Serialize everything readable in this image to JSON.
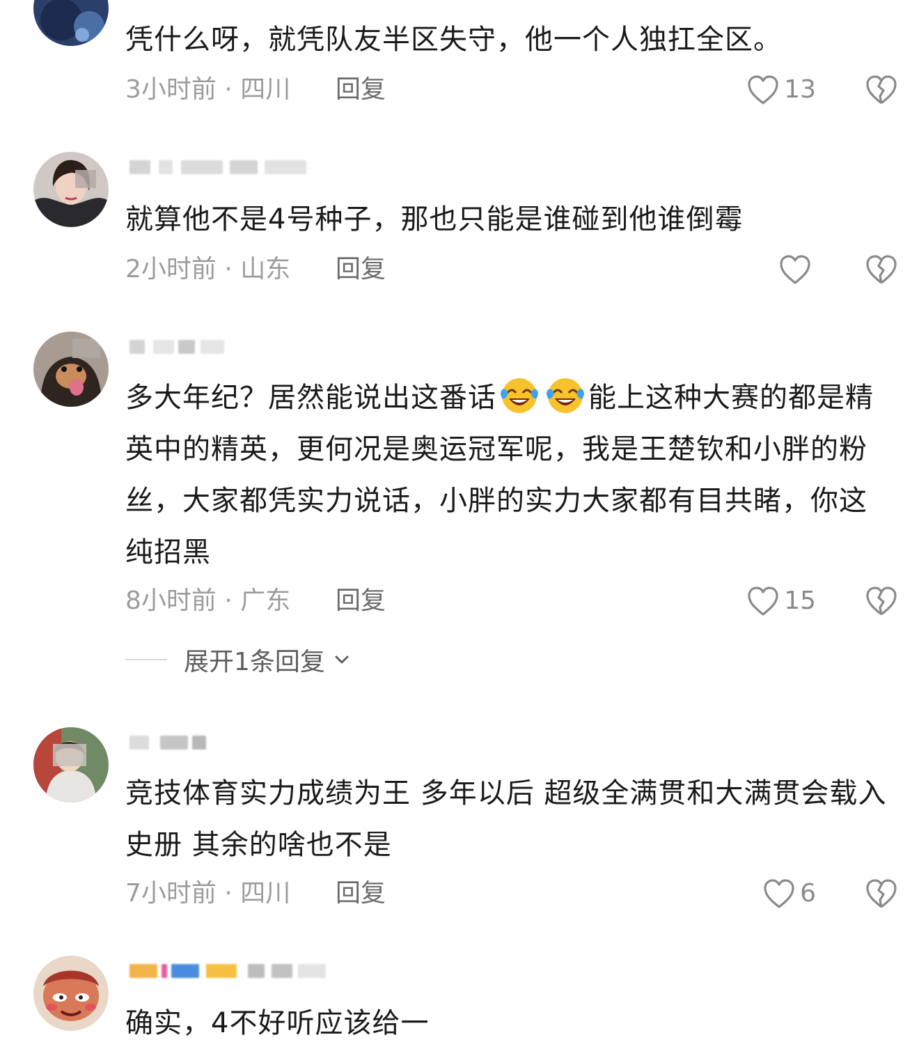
{
  "comments": [
    {
      "text": "凭什么呀，就凭队友半区失守，他一个人独扛全区。",
      "time": "3小时前 · 四川",
      "reply": "回复",
      "likes": "13"
    },
    {
      "text": "就算他不是4号种子，那也只能是谁碰到他谁倒霉",
      "time": "2小时前 · 山东",
      "reply": "回复",
      "likes": ""
    },
    {
      "text_part1": "多大年纪？居然能说出这番话",
      "text_part2": "能上这种大赛的都是精英中的精英，更何况是奥运冠军呢，我是王楚钦和小胖的粉丝，大家都凭实力说话，小胖的实力大家都有目共睹，你这纯招黑",
      "time": "8小时前 · 广东",
      "reply": "回复",
      "likes": "15",
      "expand": "展开1条回复"
    },
    {
      "text": "竞技体育实力成绩为王 多年以后 超级全满贯和大满贯会载入史册 其余的啥也不是",
      "time": "7小时前 · 四川",
      "reply": "回复",
      "likes": "6"
    },
    {
      "text": "确实，4不好听应该给一"
    }
  ],
  "icons": {
    "like": "heart-outline-icon",
    "dislike": "broken-heart-icon",
    "expand": "chevron-down-icon",
    "emoji": "tears-of-joy-emoji"
  },
  "colors": {
    "text": "#1a1a1a",
    "meta": "#9c9c9c",
    "reply": "#6c6c6c",
    "icon": "#8a8a8a"
  }
}
